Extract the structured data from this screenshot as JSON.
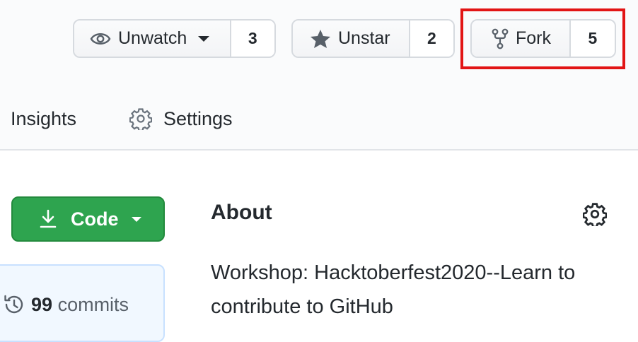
{
  "repo_actions": {
    "watch": {
      "label": "Unwatch",
      "count": "3",
      "icon": "eye-icon"
    },
    "star": {
      "label": "Unstar",
      "count": "2",
      "icon": "star-icon"
    },
    "fork": {
      "label": "Fork",
      "count": "5",
      "icon": "fork-icon"
    }
  },
  "nav": {
    "insights_label": "Insights",
    "settings_label": "Settings",
    "settings_icon": "gear-icon"
  },
  "code_button": {
    "label": "Code",
    "icon": "download-icon"
  },
  "commits": {
    "count": "99",
    "label": "commits",
    "icon": "history-icon"
  },
  "about": {
    "title": "About",
    "description": "Workshop: Hacktoberfest2020--Learn to contribute to GitHub",
    "settings_icon": "gear-icon"
  },
  "colors": {
    "highlight": "#e21515",
    "code_button": "#2ea44f",
    "header_bg": "#fafbfc"
  }
}
